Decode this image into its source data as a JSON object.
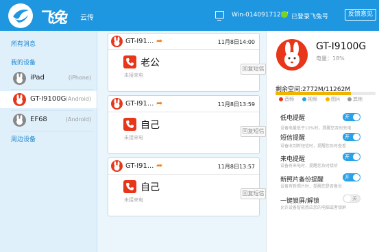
{
  "header": {
    "brand": "飞兔",
    "product": "云传",
    "pc_name": "Win-01409171227",
    "login_text": "已登录飞兔号",
    "feedback_label": "反馈意见"
  },
  "sidebar": {
    "all_messages": "所有消息",
    "my_devices": "我的设备",
    "devices": [
      {
        "name": "iPad",
        "type": "(iPhone)",
        "active": false
      },
      {
        "name": "GT-I9100G",
        "type": "(Android)",
        "active": true
      },
      {
        "name": "EF68",
        "type": "(Android)",
        "active": false
      }
    ],
    "nearby": "周边设备"
  },
  "messages": [
    {
      "sender": "GT-I91...",
      "date": "11月8日14:00",
      "caller": "老公",
      "status": "未接来电",
      "reply_label": "回复短信"
    },
    {
      "sender": "GT-I91...",
      "date": "11月8日13:59",
      "caller": "自己",
      "status": "未接来电",
      "reply_label": "回复短信"
    },
    {
      "sender": "GT-I91...",
      "date": "11月8日13:57",
      "caller": "自己",
      "status": "未接来电",
      "reply_label": "回复短信"
    }
  ],
  "device": {
    "model": "GT-I9100G",
    "battery": "电量：18%",
    "storage": "剩余空间:2772M/11262M",
    "storage_used_fraction": 0.754,
    "legend": [
      {
        "label": "音频",
        "color": "#e8361a"
      },
      {
        "label": "视频",
        "color": "#2aa2e8"
      },
      {
        "label": "图片",
        "color": "#f0b400"
      },
      {
        "label": "其他",
        "color": "#999999"
      }
    ],
    "settings": [
      {
        "title": "低电提醒",
        "desc": "设备电量低于10%时，提醒您及时充电",
        "on": true,
        "toggle_label": "开"
      },
      {
        "title": "短信提醒",
        "desc": "设备收到新短信时，提醒您及时查看",
        "on": true,
        "toggle_label": "开"
      },
      {
        "title": "来电提醒",
        "desc": "设备有来电时，提醒您及时接听",
        "on": true,
        "toggle_label": "开"
      },
      {
        "title": "新照片备份提醒",
        "desc": "设备有新照片时，提醒您是否备份",
        "on": true,
        "toggle_label": "开"
      },
      {
        "title": "一键锁屏/解锁",
        "desc": "允许设备智能感应您的电脑或者锁屏",
        "on": false,
        "toggle_label": "关"
      }
    ]
  }
}
